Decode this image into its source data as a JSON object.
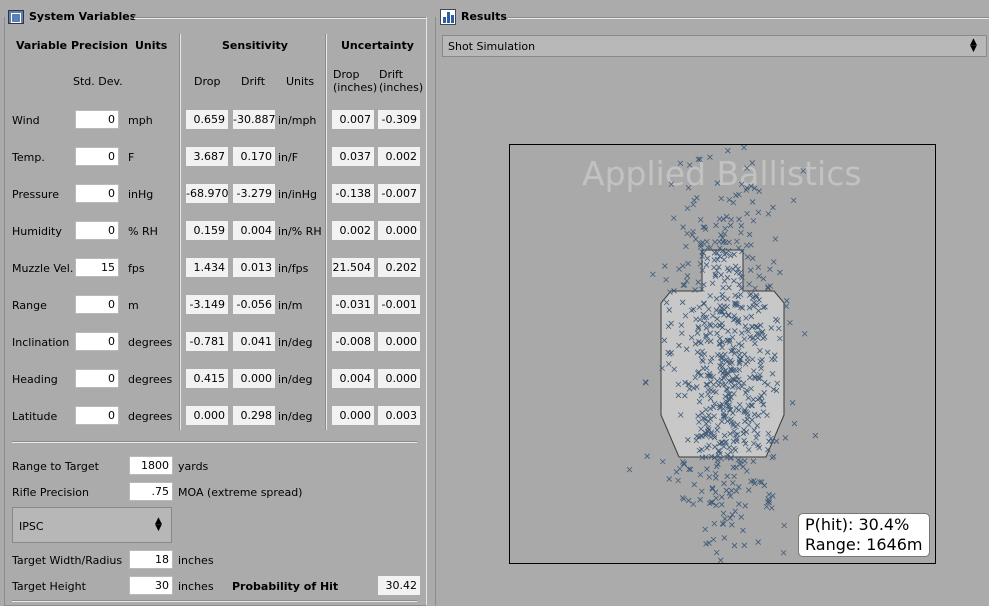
{
  "left_panel": {
    "title": "System Variables",
    "headers": {
      "variable": "Variable",
      "precision": "Precision",
      "units": "Units",
      "sensitivity": "Sensitivity",
      "uncertainty": "Uncertainty",
      "std_dev": "Std. Dev.",
      "drop": "Drop",
      "drift": "Drift",
      "sens_units": "Units",
      "unc_drop": "Drop\n(inches)",
      "unc_drift": "Drift\n(inches)"
    },
    "rows": [
      {
        "name": "Wind",
        "std": "0",
        "unit": "mph",
        "drop": "0.659",
        "drift": "-30.887",
        "sunit": "in/mph",
        "udrop": "0.007",
        "udrift": "-0.309"
      },
      {
        "name": "Temp.",
        "std": "0",
        "unit": "F",
        "drop": "3.687",
        "drift": "0.170",
        "sunit": "in/F",
        "udrop": "0.037",
        "udrift": "0.002"
      },
      {
        "name": "Pressure",
        "std": "0",
        "unit": "inHg",
        "drop": "-68.970",
        "drift": "-3.279",
        "sunit": "in/inHg",
        "udrop": "-0.138",
        "udrift": "-0.007"
      },
      {
        "name": "Humidity",
        "std": "0",
        "unit": "% RH",
        "drop": "0.159",
        "drift": "0.004",
        "sunit": "in/% RH",
        "udrop": "0.002",
        "udrift": "0.000"
      },
      {
        "name": "Muzzle Vel.",
        "std": "15",
        "unit": "fps",
        "drop": "1.434",
        "drift": "0.013",
        "sunit": "in/fps",
        "udrop": "21.504",
        "udrift": "0.202"
      },
      {
        "name": "Range",
        "std": "0",
        "unit": "m",
        "drop": "-3.149",
        "drift": "-0.056",
        "sunit": "in/m",
        "udrop": "-0.031",
        "udrift": "-0.001"
      },
      {
        "name": "Inclination",
        "std": "0",
        "unit": "degrees",
        "drop": "-0.781",
        "drift": "0.041",
        "sunit": "in/deg",
        "udrop": "-0.008",
        "udrift": "0.000"
      },
      {
        "name": "Heading",
        "std": "0",
        "unit": "degrees",
        "drop": "0.415",
        "drift": "0.000",
        "sunit": "in/deg",
        "udrop": "0.004",
        "udrift": "0.000"
      },
      {
        "name": "Latitude",
        "std": "0",
        "unit": "degrees",
        "drop": "0.000",
        "drift": "0.298",
        "sunit": "in/deg",
        "udrop": "0.000",
        "udrift": "0.003"
      }
    ],
    "bottom": {
      "range_label": "Range to Target",
      "range_value": "1800",
      "range_unit": "yards",
      "rifle_label": "Rifle Precision",
      "rifle_value": ".75",
      "rifle_unit": "MOA (extreme spread)",
      "target_type": "IPSC",
      "width_label": "Target Width/Radius",
      "width_value": "18",
      "width_unit": "inches",
      "height_label": "Target Height",
      "height_value": "30",
      "height_unit": "inches",
      "prob_label": "Probability of Hit",
      "prob_value": "30.42"
    }
  },
  "right_panel": {
    "title": "Results",
    "view_select": "Shot Simulation",
    "watermark": "Applied Ballistics",
    "phit": "P(hit): 30.4%",
    "range_readout": "Range: 1646m",
    "colors": {
      "marker": "#3e5a78",
      "target_fill": "#c8c8c8",
      "plot_bg": "#a9a9a9"
    }
  },
  "icons": {
    "left": "system-variables-icon",
    "right": "results-chart-icon"
  }
}
